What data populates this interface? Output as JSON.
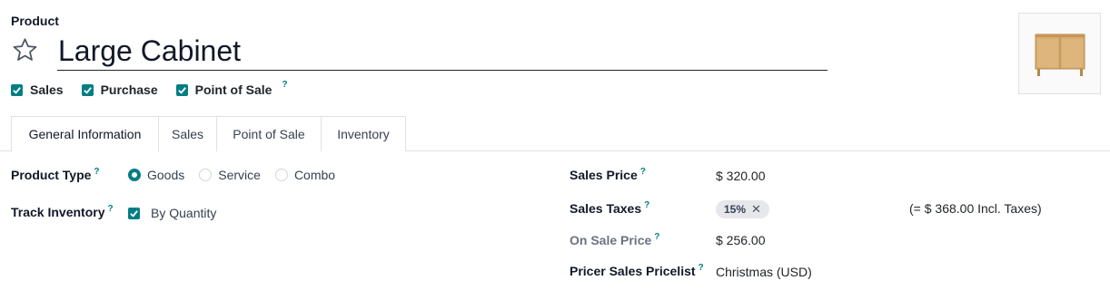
{
  "header": {
    "caption": "Product",
    "name": "Large Cabinet",
    "favorite_icon": "star-outline-icon"
  },
  "flags": [
    {
      "label": "Sales",
      "checked": true,
      "help": ""
    },
    {
      "label": "Purchase",
      "checked": true,
      "help": ""
    },
    {
      "label": "Point of Sale",
      "checked": true,
      "help": "?"
    }
  ],
  "tabs": [
    {
      "label": "General Information",
      "active": true
    },
    {
      "label": "Sales",
      "active": false
    },
    {
      "label": "Point of Sale",
      "active": false
    },
    {
      "label": "Inventory",
      "active": false
    }
  ],
  "general": {
    "product_type": {
      "label": "Product Type",
      "help": "?",
      "options": [
        "Goods",
        "Service",
        "Combo"
      ],
      "selected": "Goods"
    },
    "track_inventory": {
      "label": "Track Inventory",
      "help": "?",
      "checked": true,
      "value": "By Quantity"
    },
    "sales_price": {
      "label": "Sales Price",
      "help": "?",
      "value": "$ 320.00"
    },
    "sales_taxes": {
      "label": "Sales Taxes",
      "help": "?",
      "tag": "15%",
      "incl_text": "(= $ 368.00 Incl. Taxes)"
    },
    "on_sale_price": {
      "label": "On Sale Price",
      "help": "?",
      "value": "$ 256.00"
    },
    "pricelist": {
      "label": "Pricer Sales Pricelist",
      "help": "?",
      "value": "Christmas (USD)"
    }
  },
  "colors": {
    "accent": "#017e84",
    "tag_bg": "#e5e7eb"
  }
}
